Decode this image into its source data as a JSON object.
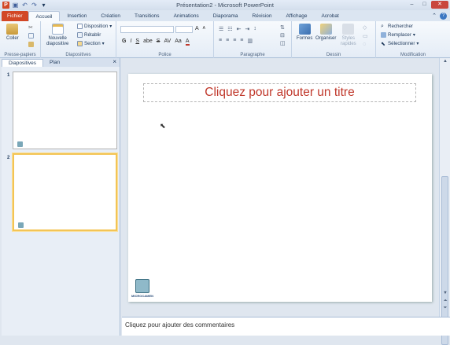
{
  "window": {
    "title": "Présentation2 - Microsoft PowerPoint"
  },
  "qat": {
    "icons": [
      "powerpoint-logo",
      "save-icon",
      "undo-icon",
      "redo-icon",
      "customize-qat-icon"
    ]
  },
  "tabs": [
    "Fichier",
    "Accueil",
    "Insertion",
    "Création",
    "Transitions",
    "Animations",
    "Diaporama",
    "Révision",
    "Affichage",
    "Acrobat"
  ],
  "active_tab": "Accueil",
  "ribbon": {
    "clipboard": {
      "label": "Presse-papiers",
      "paste": "Coller"
    },
    "slides": {
      "label": "Diapositives",
      "new_slide": "Nouvelle",
      "new_slide2": "diapositive",
      "layout": "Disposition",
      "reset": "Rétablir",
      "section": "Section"
    },
    "font": {
      "label": "Police",
      "bold": "G",
      "italic": "I",
      "underline": "S",
      "strike": "S",
      "shadow": "abe",
      "spacing": "AV",
      "case": "Aa",
      "grow": "A",
      "shrink": "A"
    },
    "paragraph": {
      "label": "Paragraphe"
    },
    "drawing": {
      "label": "Dessin",
      "shapes": "Formes",
      "arrange": "Organiser",
      "quick_styles": "Styles",
      "quick_styles2": "rapides"
    },
    "editing": {
      "label": "Modification",
      "find": "Rechercher",
      "replace": "Remplacer",
      "select": "Sélectionner"
    }
  },
  "panel": {
    "tab_slides": "Diapositives",
    "tab_outline": "Plan",
    "thumbs": [
      {
        "num": "1"
      },
      {
        "num": "2"
      }
    ]
  },
  "slide": {
    "title_placeholder": "Cliquez pour ajouter un titre",
    "logo_text": "MICROCAMEN"
  },
  "notes": {
    "placeholder": "Cliquez pour ajouter des commentaires"
  },
  "colors": {
    "file_tab": "#d24726",
    "title_text": "#c0382b",
    "selected_thumb": "#f3c455"
  }
}
